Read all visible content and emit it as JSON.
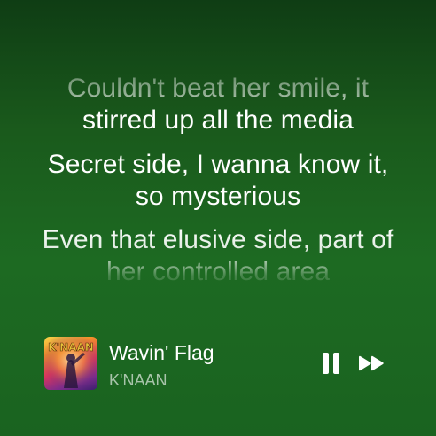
{
  "lyrics": {
    "line1": "Couldn't beat her smile, it stirred up all the media",
    "line2": "Secret side, I wanna know it, so mysterious",
    "line3": "Even that elusive side, part of her controlled area"
  },
  "now_playing": {
    "title": "Wavin' Flag",
    "artist": "K'NAAN",
    "album_art_text": "K'NAAN",
    "state": "playing"
  },
  "controls": {
    "pause_icon": "pause-icon",
    "next_icon": "skip-forward-icon"
  },
  "colors": {
    "background_top": "#0f3d14",
    "background_bottom": "#1a6320",
    "text": "#ffffff",
    "secondary_text": "rgba(255,255,255,0.62)"
  }
}
